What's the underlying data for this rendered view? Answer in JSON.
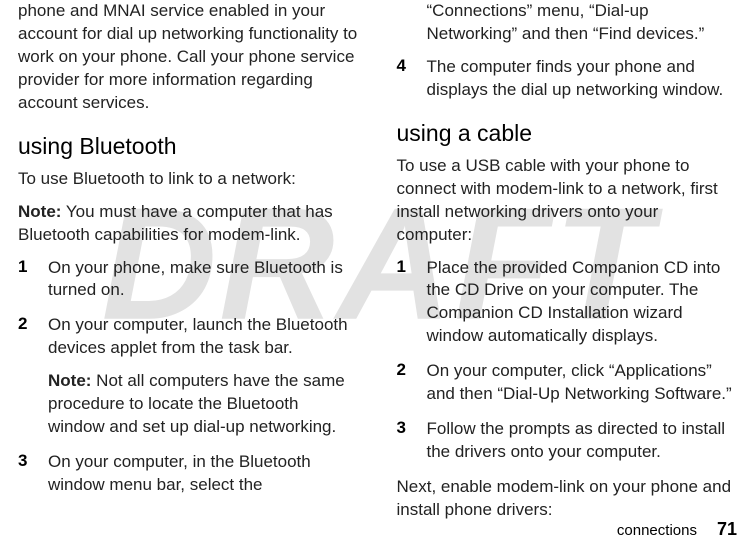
{
  "watermark": "DRAFT",
  "left": {
    "leadin": "phone and MNAI service enabled in your account for dial up networking functionality to work on your phone. Call your phone service provider for more information regarding account services.",
    "h2": "using Bluetooth",
    "intro": "To use Bluetooth to link to a network:",
    "note_label": "Note:",
    "note_body": " You must have a computer that has Bluetooth capabilities for modem-link.",
    "steps": [
      {
        "n": "1",
        "text": "On your phone, make sure Bluetooth is turned on."
      },
      {
        "n": "2",
        "text": "On your computer, launch the Bluetooth devices applet from the task bar.",
        "subnote_label": "Note:",
        "subnote_body": " Not all computers have the same procedure to locate the Bluetooth window and set up dial-up networking."
      },
      {
        "n": "3",
        "text": "On your computer, in the Bluetooth window menu bar, select the"
      }
    ]
  },
  "right": {
    "cont": "“Connections” menu, “Dial-up Networking” and then “Find devices.”",
    "step4": {
      "n": "4",
      "text": "The computer finds your phone and displays the dial up networking window."
    },
    "h2": "using a cable",
    "intro": "To use a USB cable with your phone to connect with modem-link to a network, first install networking drivers onto your computer:",
    "steps": [
      {
        "n": "1",
        "text": "Place the provided Companion CD into the CD Drive on your computer. The Companion CD Installation wizard window automatically displays."
      },
      {
        "n": "2",
        "text": "On your computer, click “Applications” and then “Dial-Up Networking Software.”"
      },
      {
        "n": "3",
        "text": "Follow the prompts as directed to install the drivers onto your computer."
      }
    ],
    "outro": "Next, enable modem-link on your phone and install phone drivers:"
  },
  "footer": {
    "chapter": "connections",
    "page": "71"
  }
}
